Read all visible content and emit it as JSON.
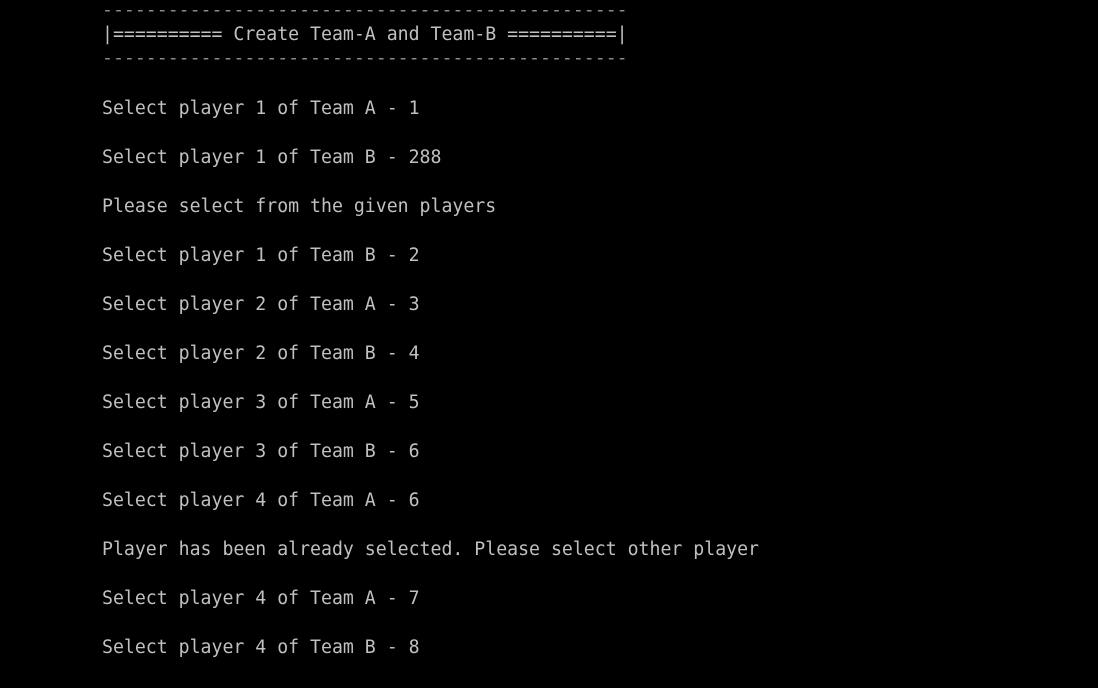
{
  "theme": {
    "background": "#000000",
    "foreground": "#c0c0c0"
  },
  "header": {
    "divider_top": "------------------------------------------------",
    "title": "|========== Create Team-A and Team-B ==========|",
    "divider_bottom": "------------------------------------------------"
  },
  "output": [
    "Select player 1 of Team A - 1",
    "Select player 1 of Team B - 288",
    "Please select from the given players",
    "Select player 1 of Team B - 2",
    "Select player 2 of Team A - 3",
    "Select player 2 of Team B - 4",
    "Select player 3 of Team A - 5",
    "Select player 3 of Team B - 6",
    "Select player 4 of Team A - 6",
    "Player has been already selected. Please select other player",
    "Select player 4 of Team A - 7",
    "Select player 4 of Team B - 8"
  ]
}
